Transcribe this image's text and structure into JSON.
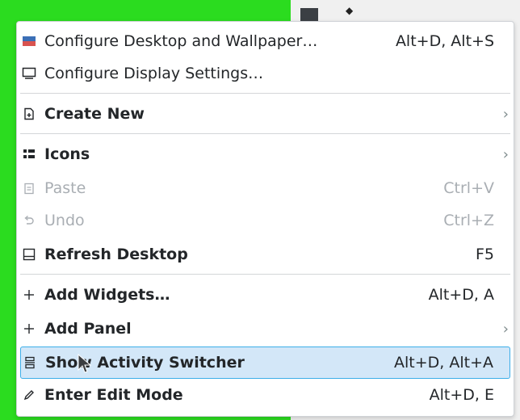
{
  "menu": {
    "items": [
      {
        "label": "Configure Desktop and Wallpaper…",
        "shortcut": "Alt+D, Alt+S",
        "icon": "wallpaper-icon"
      },
      {
        "label": "Configure Display Settings…",
        "shortcut": "",
        "icon": "monitor-icon"
      },
      {
        "label": "Create New",
        "shortcut": "",
        "icon": "new-file-icon",
        "submenu": true
      },
      {
        "label": "Icons",
        "shortcut": "",
        "icon": "icons-grid-icon",
        "submenu": true
      },
      {
        "label": "Paste",
        "shortcut": "Ctrl+V",
        "icon": "paste-icon",
        "disabled": true
      },
      {
        "label": "Undo",
        "shortcut": "Ctrl+Z",
        "icon": "undo-icon",
        "disabled": true
      },
      {
        "label": "Refresh Desktop",
        "shortcut": "F5",
        "icon": "refresh-icon"
      },
      {
        "label": "Add Widgets…",
        "shortcut": "Alt+D, A",
        "icon": "plus-icon"
      },
      {
        "label": "Add Panel",
        "shortcut": "",
        "icon": "plus-icon",
        "submenu": true
      },
      {
        "label": "Show Activity Switcher",
        "shortcut": "Alt+D, Alt+A",
        "icon": "activities-icon",
        "highlighted": true
      },
      {
        "label": "Enter Edit Mode",
        "shortcut": "Alt+D, E",
        "icon": "edit-icon"
      }
    ]
  },
  "colors": {
    "highlight_bg": "#d3e7f8",
    "highlight_border": "#3daee9",
    "disabled_text": "#a9aeb3"
  }
}
